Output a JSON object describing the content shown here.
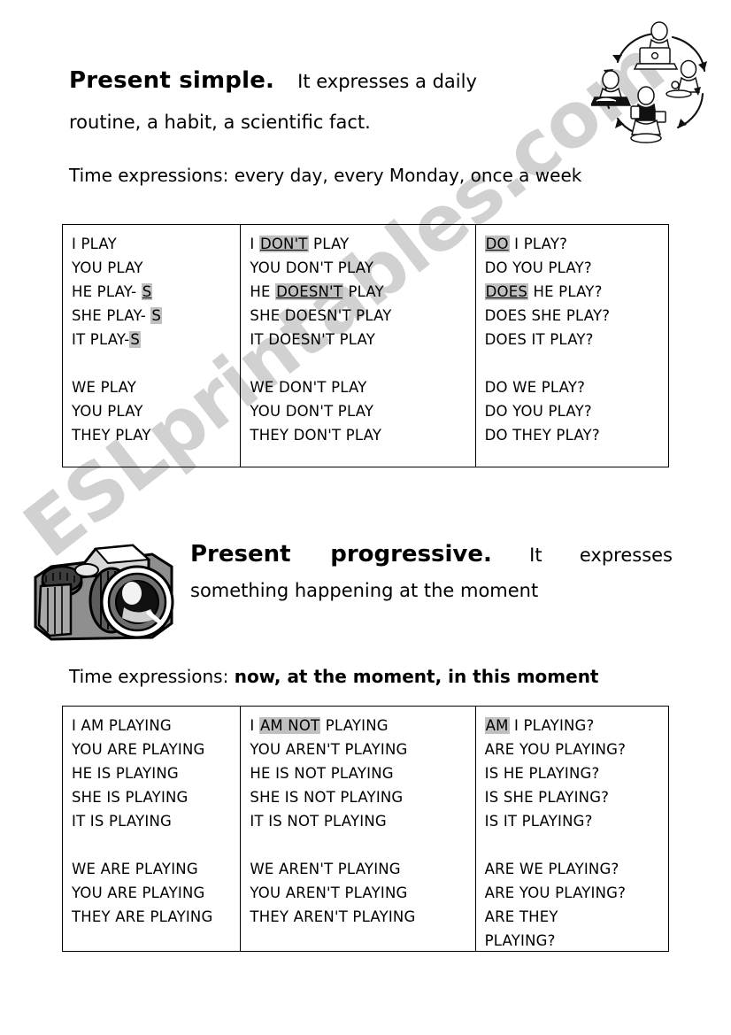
{
  "watermark": {
    "text": "ESLprintables.com",
    "color": "#c9c9c9"
  },
  "present_simple": {
    "title": "Present simple.",
    "description_part1": "It expresses a daily",
    "description_part2": "routine, a habit, a scientific fact.",
    "time_expressions_label": "Time expressions:",
    "time_expressions": " every day, every Monday, once a week",
    "table": {
      "affirmative": [
        {
          "pre": "I PLAY",
          "hl": "",
          "post": ""
        },
        {
          "pre": "YOU PLAY",
          "hl": "",
          "post": ""
        },
        {
          "pre": "HE PLAY- ",
          "hl": "S",
          "post": "",
          "underline": true
        },
        {
          "pre": "SHE PLAY- ",
          "hl": "S",
          "post": ""
        },
        {
          "pre": "IT PLAY-",
          "hl": "S",
          "post": ""
        },
        {
          "pre": "",
          "hl": "",
          "post": "",
          "blank": true
        },
        {
          "pre": "WE PLAY",
          "hl": "",
          "post": ""
        },
        {
          "pre": "YOU PLAY",
          "hl": "",
          "post": ""
        },
        {
          "pre": "THEY PLAY",
          "hl": "",
          "post": ""
        }
      ],
      "negative": [
        {
          "pre": "I ",
          "hl": "DON'T",
          "post": " PLAY",
          "underline": true
        },
        {
          "pre": "YOU DON'T PLAY",
          "hl": "",
          "post": ""
        },
        {
          "pre": "HE ",
          "hl": "DOESN'T",
          "post": " PLAY",
          "underline": true
        },
        {
          "pre": "SHE DOESN'T PLAY",
          "hl": "",
          "post": ""
        },
        {
          "pre": "IT DOESN'T PLAY",
          "hl": "",
          "post": ""
        },
        {
          "pre": "",
          "hl": "",
          "post": "",
          "blank": true
        },
        {
          "pre": "WE DON'T PLAY",
          "hl": "",
          "post": ""
        },
        {
          "pre": "YOU DON'T PLAY",
          "hl": "",
          "post": ""
        },
        {
          "pre": "THEY DON'T PLAY",
          "hl": "",
          "post": ""
        }
      ],
      "interrogative": [
        {
          "pre": "",
          "hl": "DO",
          "post": " I PLAY?",
          "underline": true
        },
        {
          "pre": "DO YOU PLAY?",
          "hl": "",
          "post": ""
        },
        {
          "pre": "",
          "hl": "DOES",
          "post": " HE PLAY?",
          "underline": true
        },
        {
          "pre": "DOES SHE PLAY?",
          "hl": "",
          "post": ""
        },
        {
          "pre": "DOES IT PLAY?",
          "hl": "",
          "post": ""
        },
        {
          "pre": "",
          "hl": "",
          "post": "",
          "blank": true
        },
        {
          "pre": "DO WE PLAY?",
          "hl": "",
          "post": ""
        },
        {
          "pre": "DO YOU PLAY?",
          "hl": "",
          "post": ""
        },
        {
          "pre": "DO THEY PLAY?",
          "hl": "",
          "post": ""
        }
      ]
    }
  },
  "present_progressive": {
    "title": "Present progressive.",
    "description": " It expresses something happening at the moment",
    "time_expressions_label": "Time expressions: ",
    "time_expressions": "now, at the moment, in this moment",
    "table": {
      "affirmative": [
        {
          "pre": "I AM PLAYING",
          "hl": "",
          "post": ""
        },
        {
          "pre": "YOU ARE PLAYING",
          "hl": "",
          "post": ""
        },
        {
          "pre": "HE IS PLAYING",
          "hl": "",
          "post": ""
        },
        {
          "pre": "SHE IS PLAYING",
          "hl": "",
          "post": ""
        },
        {
          "pre": "IT IS PLAYING",
          "hl": "",
          "post": ""
        },
        {
          "pre": "",
          "hl": "",
          "post": "",
          "blank": true
        },
        {
          "pre": "WE ARE PLAYING",
          "hl": "",
          "post": ""
        },
        {
          "pre": "YOU ARE PLAYING",
          "hl": "",
          "post": ""
        },
        {
          "pre": "THEY ARE PLAYING",
          "hl": "",
          "post": ""
        }
      ],
      "negative": [
        {
          "pre": "I ",
          "hl": "AM NOT",
          "post": " PLAYING"
        },
        {
          "pre": "YOU AREN'T PLAYING",
          "hl": "",
          "post": ""
        },
        {
          "pre": "HE IS NOT PLAYING",
          "hl": "",
          "post": ""
        },
        {
          "pre": "SHE IS NOT PLAYING",
          "hl": "",
          "post": ""
        },
        {
          "pre": "IT IS NOT PLAYING",
          "hl": "",
          "post": ""
        },
        {
          "pre": "",
          "hl": "",
          "post": "",
          "blank": true
        },
        {
          "pre": "WE AREN'T PLAYING",
          "hl": "",
          "post": ""
        },
        {
          "pre": "YOU AREN'T PLAYING",
          "hl": "",
          "post": ""
        },
        {
          "pre": "THEY AREN'T PLAYING",
          "hl": "",
          "post": ""
        }
      ],
      "interrogative": [
        {
          "pre": "",
          "hl": "AM",
          "post": " I PLAYING?"
        },
        {
          "pre": "ARE YOU PLAYING?",
          "hl": "",
          "post": ""
        },
        {
          "pre": "IS HE PLAYING?",
          "hl": "",
          "post": ""
        },
        {
          "pre": "IS SHE PLAYING?",
          "hl": "",
          "post": ""
        },
        {
          "pre": "IS IT PLAYING?",
          "hl": "",
          "post": ""
        },
        {
          "pre": "",
          "hl": "",
          "post": "",
          "blank": true
        },
        {
          "pre": "ARE WE PLAYING?",
          "hl": "",
          "post": ""
        },
        {
          "pre": "ARE YOU PLAYING?",
          "hl": "",
          "post": ""
        },
        {
          "pre": "ARE THEY",
          "hl": "",
          "post": ""
        },
        {
          "pre": "PLAYING?",
          "hl": "",
          "post": ""
        }
      ]
    }
  },
  "illustrations": {
    "routine_cycle": "daily-routine-cycle-clipart",
    "camera": "camera-clipart"
  }
}
